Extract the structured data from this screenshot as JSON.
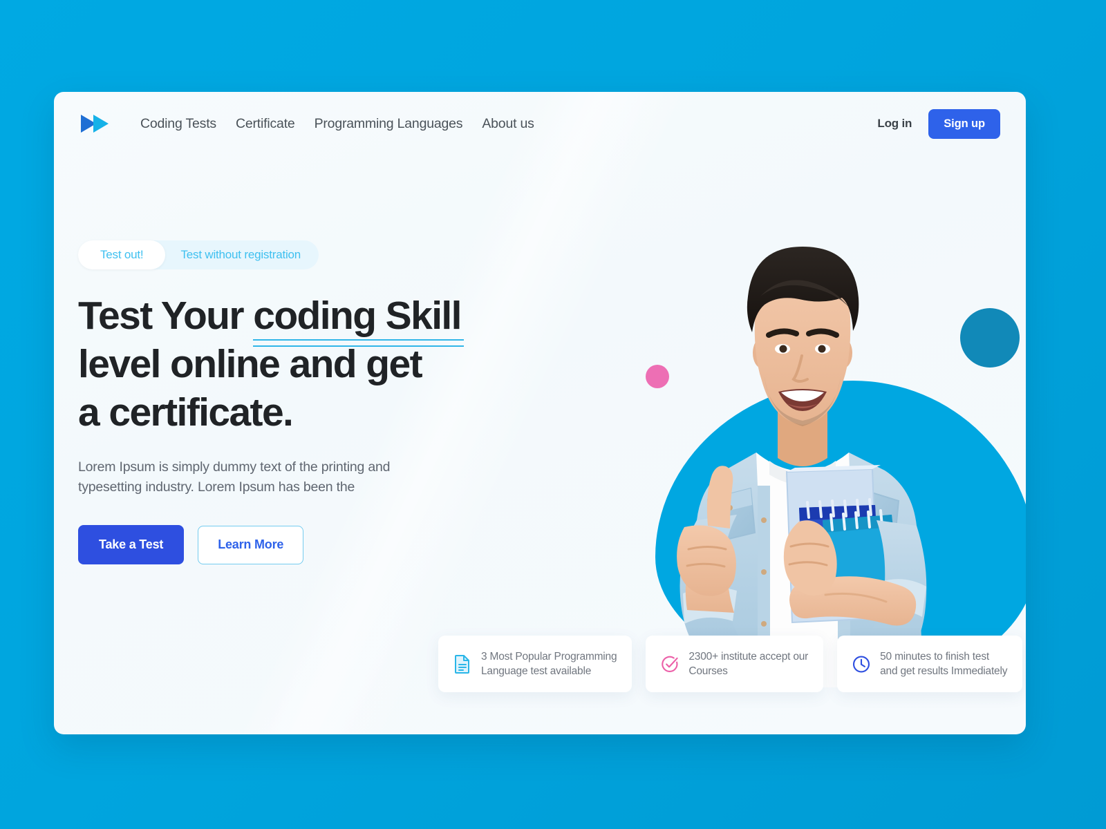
{
  "theme": {
    "page_background": "#00a7e1",
    "card_background": "#f6fafd",
    "accent_blue": "#2e62ea",
    "accent_cyan": "#00a7e1",
    "accent_light_blue": "#3fc0f0",
    "accent_pink": "#ed6fb4",
    "accent_teal": "#1189b8",
    "text_dark": "#202326",
    "text_muted": "#70767f"
  },
  "header": {
    "logo_icon": "double-fast-forward-arrow-icon",
    "nav": [
      {
        "label": "Coding Tests"
      },
      {
        "label": "Certificate"
      },
      {
        "label": "Programming Languages"
      },
      {
        "label": "About us"
      }
    ],
    "login_label": "Log in",
    "signup_label": "Sign up"
  },
  "hero": {
    "toggle": {
      "active_label": "Test out!",
      "inactive_label": "Test without registration"
    },
    "headline": {
      "line1_prefix": "Test Your ",
      "line1_underlined": "coding Skill",
      "line2": "level online and get",
      "line3": "a certificate."
    },
    "subtext": "Lorem Ipsum is simply dummy text of the printing and typesetting industry. Lorem Ipsum has been the",
    "primary_cta": "Take a Test",
    "secondary_cta": "Learn More"
  },
  "illustration": {
    "blob_shape": "organic-cyan-blob",
    "photo_subject": "smiling-student-thumbs-up-holding-notebooks",
    "decorations": [
      {
        "name": "teal-circle",
        "color": "#1189b8"
      },
      {
        "name": "pink-circle",
        "color": "#ed6fb4"
      },
      {
        "name": "blue-dot",
        "color": "#2b3fd4"
      }
    ]
  },
  "features": [
    {
      "icon": "document-file-icon",
      "icon_color": "#29b6e8",
      "line1": "3 Most Popular Programming",
      "line2": "Language test available"
    },
    {
      "icon": "check-circle-icon",
      "icon_color": "#ec5fa8",
      "line1": "2300+ institute accept our",
      "line2": "Courses"
    },
    {
      "icon": "clock-icon",
      "icon_color": "#2e4fe0",
      "line1": "50 minutes to finish test",
      "line2": "and get results Immediately"
    }
  ]
}
